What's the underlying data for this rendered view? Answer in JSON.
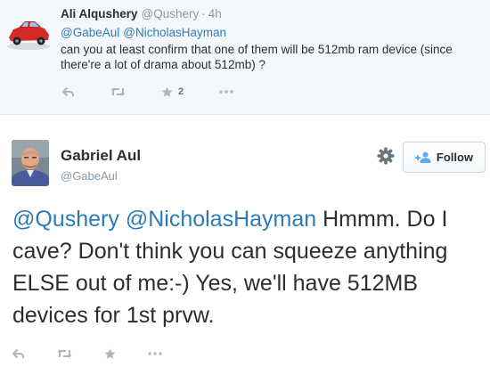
{
  "parent_tweet": {
    "author_name": "Ali Alqushery",
    "handle": "@Qushery",
    "separator": "·",
    "time": "4h",
    "mentions": [
      "@GabeAul",
      "@NicholasHayman"
    ],
    "text": "can you at least confirm that one of them will be 512mb ram device (since there're a lot of drama about 512mb) ?",
    "favorite_count": "2",
    "actions": [
      "reply-icon",
      "retweet-icon",
      "favorite-icon",
      "more-icon"
    ]
  },
  "main_tweet": {
    "author_name": "Gabriel Aul",
    "handle": "@GabeAul",
    "follow_label": "Follow",
    "mentions": [
      "@Qushery",
      "@NicholasHayman"
    ],
    "text": "Hmmm. Do I cave? Don't think you can squeeze anything ELSE out of me:-) Yes, we'll have 512MB devices for 1st prvw.",
    "actions": [
      "reply-icon",
      "retweet-icon",
      "favorite-icon",
      "more-icon"
    ]
  },
  "colors": {
    "link": "#2b7bb9",
    "muted": "#8899a6",
    "icon": "#aab8c2",
    "follow_icon": "#55acee",
    "parent_background": "#f5f8fa"
  }
}
